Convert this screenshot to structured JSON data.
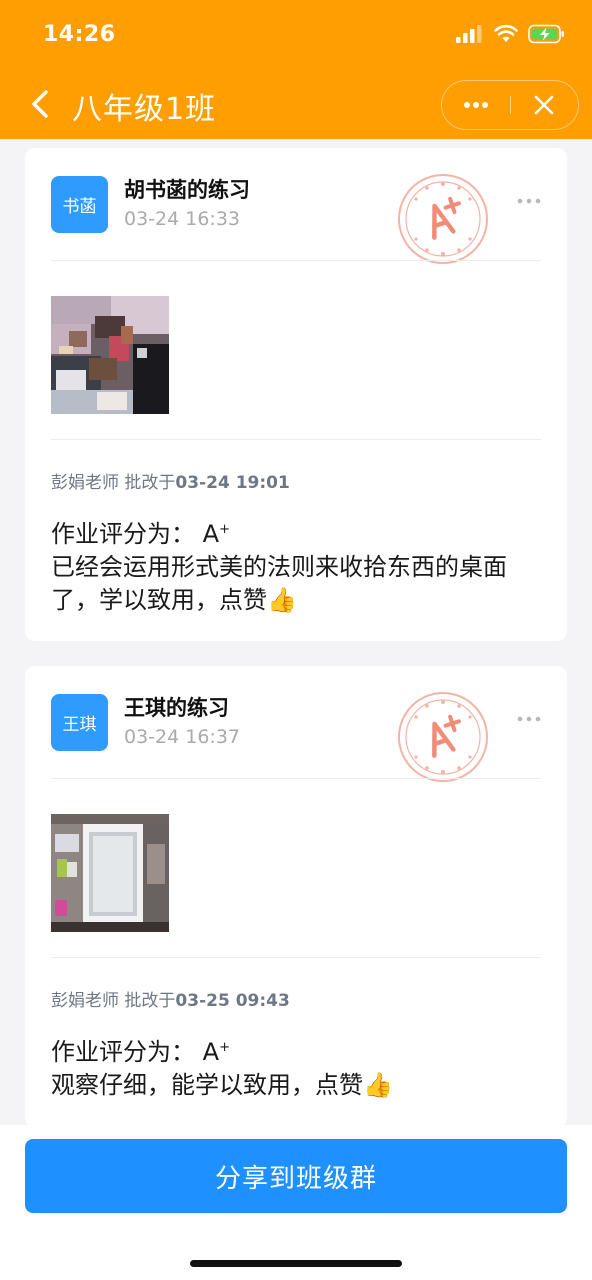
{
  "status": {
    "time": "14:26"
  },
  "nav": {
    "title": "八年级1班"
  },
  "posts": [
    {
      "avatar": "书菡",
      "name": "胡书菡的练习",
      "time": "03-24 16:33",
      "teacher": "彭娟老师",
      "action": "批改于",
      "graded_at": "03-24 19:01",
      "score_label": "作业评分为：",
      "score": "A",
      "score_sup": "+",
      "comment": "已经会运用形式美的法则来收拾东西的桌面了，学以致用，点赞👍"
    },
    {
      "avatar": "王琪",
      "name": "王琪的练习",
      "time": "03-24 16:37",
      "teacher": "彭娟老师",
      "action": "批改于",
      "graded_at": "03-25 09:43",
      "score_label": "作业评分为：",
      "score": "A",
      "score_sup": "+",
      "comment": "观察仔细，能学以致用，点赞👍"
    }
  ],
  "footer": {
    "share_label": "分享到班级群"
  },
  "colors": {
    "brand": "#ff9e00",
    "primary": "#1e90ff",
    "avatar": "#2f9bff",
    "stamp": "#f3a896"
  },
  "icons": [
    "signal-icon",
    "wifi-icon",
    "battery-icon",
    "back-icon",
    "more-icon",
    "close-icon",
    "grade-stamp-icon"
  ]
}
